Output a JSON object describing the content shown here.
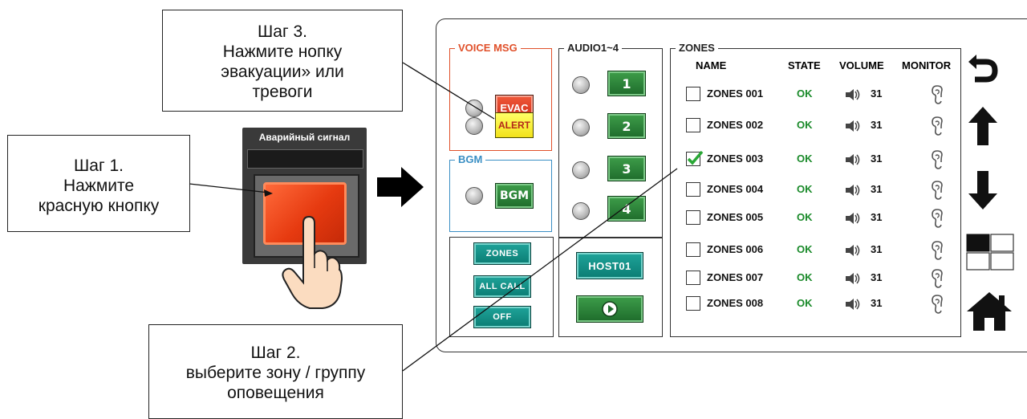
{
  "callouts": {
    "step3": [
      "Шаг 3.",
      "Нажмите нопку",
      "эвакуации» или",
      "тревоги"
    ],
    "step1": [
      "Шаг 1.",
      "Нажмите",
      "красную кнопку"
    ],
    "step2": [
      "Шаг 2.",
      "выберите зону / группу",
      "оповещения"
    ]
  },
  "hardware": {
    "label": "Аварийный сигнал"
  },
  "voice_msg": {
    "title": "VOICE MSG",
    "evac_label": "EVAC",
    "alert_label": "ALERT"
  },
  "bgm": {
    "title": "BGM",
    "button_label": "BGM"
  },
  "audio": {
    "title": "AUDIO1~4",
    "buttons": [
      "1",
      "2",
      "3",
      "4"
    ]
  },
  "mode": {
    "zones_label": "ZONES",
    "allcall_label": "ALL CALL",
    "off_label": "OFF"
  },
  "host": {
    "label": "HOST01"
  },
  "zones": {
    "title": "ZONES",
    "headers": {
      "name": "NAME",
      "state": "STATE",
      "volume": "VOLUME",
      "monitor": "MONITOR"
    },
    "rows": [
      {
        "name": "ZONES 001",
        "state": "OK",
        "volume": "31",
        "checked": false
      },
      {
        "name": "ZONES 002",
        "state": "OK",
        "volume": "31",
        "checked": false
      },
      {
        "name": "ZONES 003",
        "state": "OK",
        "volume": "31",
        "checked": true
      },
      {
        "name": "ZONES 004",
        "state": "OK",
        "volume": "31",
        "checked": false
      },
      {
        "name": "ZONES 005",
        "state": "OK",
        "volume": "31",
        "checked": false
      },
      {
        "name": "ZONES 006",
        "state": "OK",
        "volume": "31",
        "checked": false
      },
      {
        "name": "ZONES 007",
        "state": "OK",
        "volume": "31",
        "checked": false
      },
      {
        "name": "ZONES 008",
        "state": "OK",
        "volume": "31",
        "checked": false
      }
    ]
  },
  "sidebar_icons": [
    "back-icon",
    "arrow-up-icon",
    "arrow-down-icon",
    "layout-grid-icon",
    "home-icon"
  ],
  "colors": {
    "voice_msg": "#e0502a",
    "bgm": "#3a8fc4",
    "ok_state": "#1a8a2a",
    "evac": "#d8331c",
    "alert": "#f5eb2a",
    "green_button": "#2a7a35",
    "teal_button": "#0e8b80"
  }
}
